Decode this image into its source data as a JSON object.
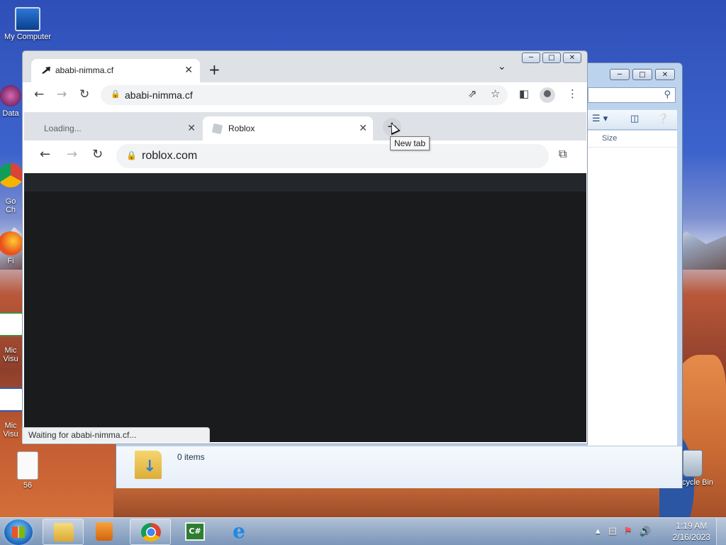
{
  "desktop": {
    "icons": [
      {
        "label": "My Computer"
      },
      {
        "label": "Data"
      },
      {
        "label": "Go\nCh"
      },
      {
        "label": "Fi"
      },
      {
        "label": "Mic\nVisu"
      },
      {
        "label": "Mic\nVisu"
      },
      {
        "label": "56"
      },
      {
        "label": "Recycle Bin"
      }
    ]
  },
  "explorer": {
    "column_size": "Size",
    "item_count": "0 items"
  },
  "chrome": {
    "tab": {
      "title": "ababi-nimma.cf"
    },
    "address": "ababi-nimma.cf",
    "status": "Waiting for ababi-nimma.cf..."
  },
  "popup": {
    "tabs": [
      {
        "title": "Loading..."
      },
      {
        "title": "Roblox"
      }
    ],
    "tooltip": "New tab",
    "address": "roblox.com"
  },
  "taskbar": {
    "time": "1:19 AM",
    "date": "2/16/2023"
  },
  "colors": {
    "page_dark": "#191b1d",
    "chrome_frame": "#dee1e6",
    "taskbar": "#8fb0d6"
  }
}
